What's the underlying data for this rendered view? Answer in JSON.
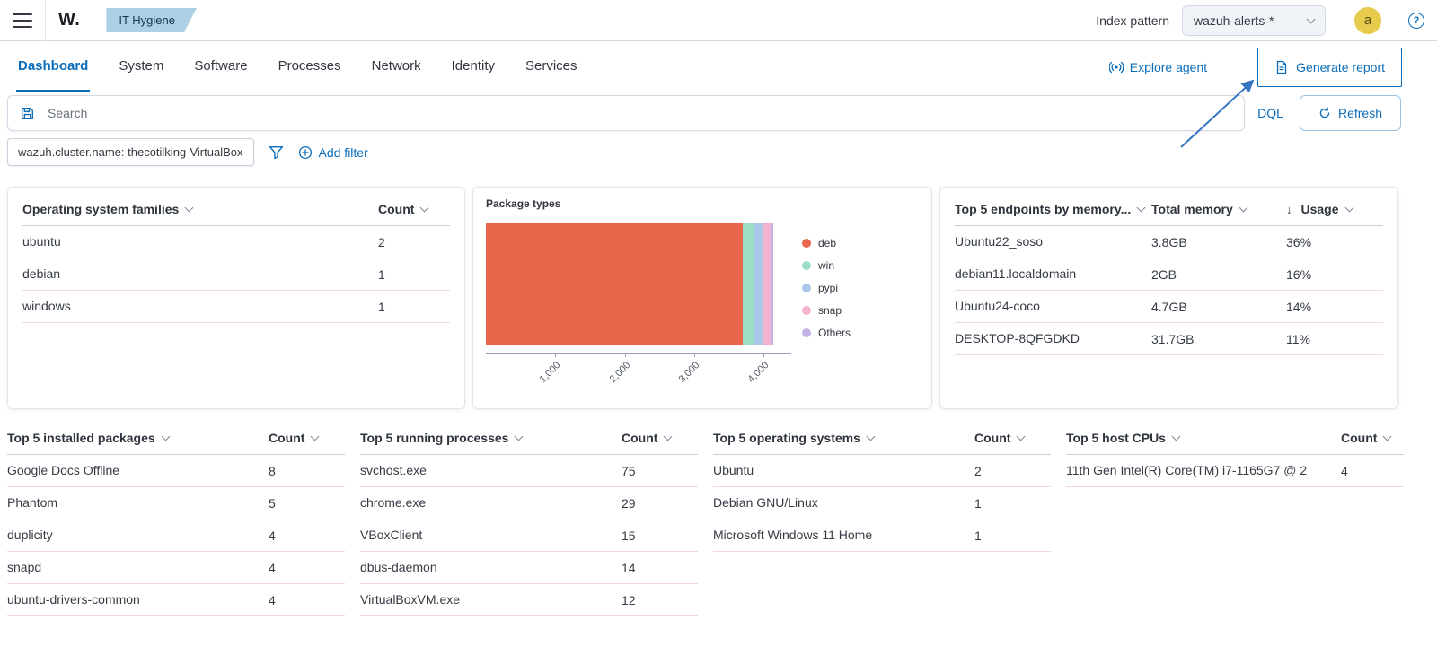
{
  "topbar": {
    "logo": "W.",
    "breadcrumb": "IT Hygiene",
    "index_pattern_label": "Index pattern",
    "index_pattern_value": "wazuh-alerts-*",
    "avatar_initial": "a"
  },
  "tabs": {
    "items": [
      "Dashboard",
      "System",
      "Software",
      "Processes",
      "Network",
      "Identity",
      "Services"
    ],
    "active": "Dashboard",
    "explore_agent_label": "Explore agent",
    "generate_report_label": "Generate report"
  },
  "query_bar": {
    "search_placeholder": "Search",
    "dql_label": "DQL",
    "refresh_label": "Refresh"
  },
  "filter_bar": {
    "filter_chip": "wazuh.cluster.name: thecotilking-VirtualBox",
    "add_filter_label": "Add filter"
  },
  "panels": {
    "os_families": {
      "title": "Operating system families",
      "columns": [
        {
          "label": "Count"
        }
      ],
      "widths": [
        "80px"
      ],
      "rows": [
        [
          "ubuntu",
          "2"
        ],
        [
          "debian",
          "1"
        ],
        [
          "windows",
          "1"
        ]
      ]
    },
    "endpoints_memory": {
      "title": "Top 5 endpoints by memory...",
      "columns": [
        {
          "label": "Total memory"
        },
        {
          "label": "Usage",
          "sorted": true
        }
      ],
      "widths": [
        "150px",
        "108px"
      ],
      "rows": [
        [
          "Ubuntu22_soso",
          "3.8GB",
          "36%"
        ],
        [
          "debian11.localdomain",
          "2GB",
          "16%"
        ],
        [
          "Ubuntu24-coco",
          "4.7GB",
          "14%"
        ],
        [
          "DESKTOP-8QFGDKD",
          "31.7GB",
          "11%"
        ]
      ]
    },
    "installed_packages": {
      "title": "Top 5 installed packages",
      "columns": [
        {
          "label": "Count"
        }
      ],
      "widths": [
        "85px"
      ],
      "rows": [
        [
          "Google Docs Offline",
          "8"
        ],
        [
          "Phantom",
          "5"
        ],
        [
          "duplicity",
          "4"
        ],
        [
          "snapd",
          "4"
        ],
        [
          "ubuntu-drivers-common",
          "4"
        ]
      ]
    },
    "running_processes": {
      "title": "Top 5 running processes",
      "columns": [
        {
          "label": "Count"
        }
      ],
      "widths": [
        "85px"
      ],
      "rows": [
        [
          "svchost.exe",
          "75"
        ],
        [
          "chrome.exe",
          "29"
        ],
        [
          "VBoxClient",
          "15"
        ],
        [
          "dbus-daemon",
          "14"
        ],
        [
          "VirtualBoxVM.exe",
          "12"
        ]
      ]
    },
    "operating_systems": {
      "title": "Top 5 operating systems",
      "columns": [
        {
          "label": "Count"
        }
      ],
      "widths": [
        "85px"
      ],
      "rows": [
        [
          "Ubuntu",
          "2"
        ],
        [
          "Debian GNU/Linux",
          "1"
        ],
        [
          "Microsoft Windows 11 Home",
          "1"
        ]
      ]
    },
    "host_cpus": {
      "title": "Top 5 host CPUs",
      "columns": [
        {
          "label": "Count"
        }
      ],
      "widths": [
        "70px"
      ],
      "rows": [
        [
          "11th Gen Intel(R) Core(TM) i7-1165G7 @ 2",
          "4"
        ]
      ]
    }
  },
  "chart_data": {
    "type": "bar",
    "orientation": "horizontal",
    "title": "Package types",
    "axis_max": 4400,
    "x_ticks": [
      1000,
      2000,
      3000,
      4000
    ],
    "x_tick_labels": [
      "1,000",
      "2,000",
      "3,000",
      "4,000"
    ],
    "series": [
      {
        "name": "deb",
        "value": 3700,
        "color": "#e7664c"
      },
      {
        "name": "win",
        "value": 170,
        "color": "#9ddec4"
      },
      {
        "name": "pypi",
        "value": 130,
        "color": "#aac8ec"
      },
      {
        "name": "snap",
        "value": 100,
        "color": "#f2b4ce"
      },
      {
        "name": "Others",
        "value": 40,
        "color": "#c3b3e4"
      }
    ],
    "legend_position": "right",
    "grid": false
  },
  "annotation": {
    "arrow_color": "#3575c2"
  }
}
